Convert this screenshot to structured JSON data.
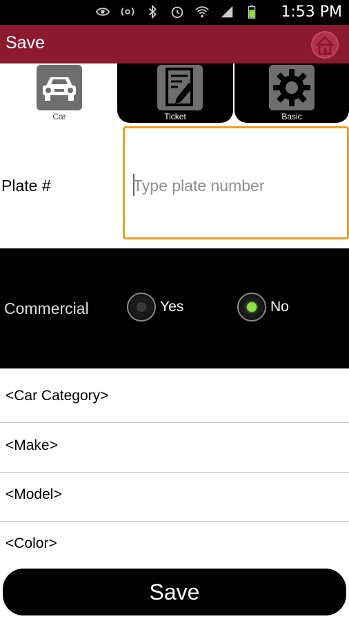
{
  "status_bar": {
    "time": "1:53 PM",
    "icons": [
      "eye-icon",
      "nfc-icon",
      "bluetooth-icon",
      "alarm-icon",
      "wifi-icon",
      "signal-icon",
      "battery-icon"
    ]
  },
  "action_bar": {
    "title": "Save",
    "home_icon": "home-icon",
    "color": "#8b1a2f"
  },
  "tabs": [
    {
      "label": "Car",
      "icon": "car-icon"
    },
    {
      "label": "Ticket",
      "icon": "ticket-icon"
    },
    {
      "label": "Basic",
      "icon": "gear-icon"
    }
  ],
  "plate": {
    "label": "Plate #",
    "placeholder": "Type plate number",
    "value": ""
  },
  "commercial": {
    "label": "Commercial",
    "options": [
      "Yes",
      "No"
    ],
    "selected": "No"
  },
  "fields": [
    "<Car Category>",
    "<Make>",
    "<Model>",
    "<Color>"
  ],
  "save_button": {
    "label": "Save"
  },
  "colors": {
    "accent": "#f39c1f",
    "brand": "#8b1a2f",
    "radio_selected": "#8be04a"
  }
}
